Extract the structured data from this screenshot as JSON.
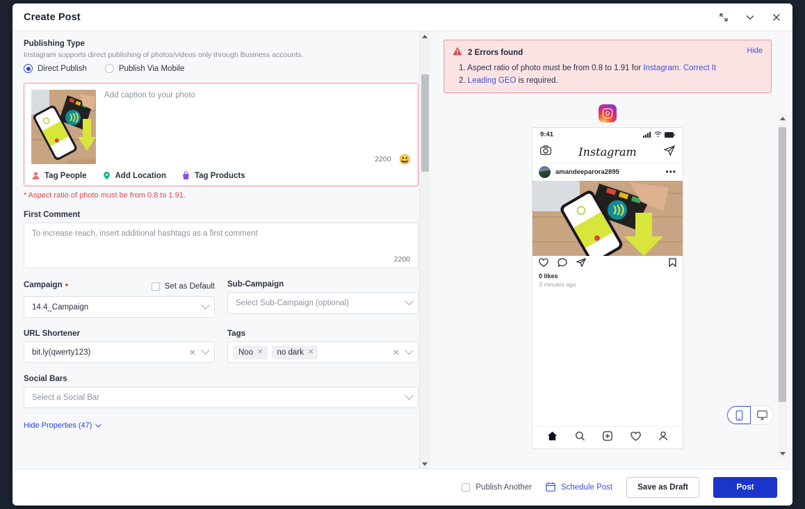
{
  "window": {
    "title": "Create Post",
    "header_icons": [
      {
        "name": "collapse-icon",
        "glyph": "collapse"
      },
      {
        "name": "chevron-down-icon",
        "glyph": "chevron-down"
      },
      {
        "name": "close-icon",
        "glyph": "close"
      }
    ]
  },
  "left": {
    "publishing_type": {
      "label": "Publishing Type",
      "description": "Instagram supports direct publishing of photos/videos only through Business accounts.",
      "options": [
        {
          "label": "Direct Publish",
          "selected": true
        },
        {
          "label": "Publish Via Mobile",
          "selected": false
        }
      ]
    },
    "media": {
      "caption_placeholder": "Add caption to your photo",
      "char_count": "2200",
      "emoji": "😃",
      "actions": [
        {
          "label": "Tag People",
          "icon": "tag-people-icon",
          "color": "#f2707a"
        },
        {
          "label": "Add Location",
          "icon": "location-pin-icon",
          "color": "#09b87e"
        },
        {
          "label": "Tag Products",
          "icon": "shopping-bag-icon",
          "color": "#8b4ee8"
        }
      ],
      "error_text": "* Aspect ratio of photo must be from 0.8 to 1.91."
    },
    "first_comment": {
      "label": "First Comment",
      "placeholder": "To increase reach, insert additional hashtags as a first comment",
      "char_count": "2200"
    },
    "campaign": {
      "label": "Campaign",
      "required": true,
      "value": "14.4_Campaign",
      "set_as_default_label": "Set as Default",
      "set_as_default_checked": false
    },
    "sub_campaign": {
      "label": "Sub-Campaign",
      "placeholder": "Select Sub-Campaign (optional)"
    },
    "url_shortener": {
      "label": "URL Shortener",
      "value": "bit.ly(qwerty123)"
    },
    "tags": {
      "label": "Tags",
      "chips": [
        "Noo",
        "no dark"
      ]
    },
    "social_bars": {
      "label": "Social Bars",
      "placeholder": "Select a Social Bar"
    },
    "hide_properties": "Hide Properties (47)"
  },
  "right": {
    "errors": {
      "title": "2 Errors found",
      "hide_label": "Hide",
      "items": [
        {
          "number": "1.",
          "text": "Aspect ratio of photo must be from 0.8 to 1.91 for ",
          "link": "Instagram. Correct It",
          "suffix": ""
        },
        {
          "number": "2.",
          "text": "",
          "link": "Leading GEO",
          "suffix": " is required."
        }
      ],
      "bg_color": "#fbe3e4",
      "border_color": "#f0969c",
      "link_color": "#3a52d8"
    },
    "preview": {
      "network_icon": "instagram-icon",
      "status_time": "9:41",
      "app_name": "Instagram",
      "username": "amandeeparora2895",
      "likes": "0 likes",
      "timestamp": "3 minutes ago",
      "nav_icons": [
        "home-icon",
        "search-icon",
        "add-post-icon",
        "heart-icon",
        "profile-icon"
      ],
      "post_icons": [
        "heart-icon",
        "comment-icon",
        "share-icon",
        "bookmark-icon"
      ]
    },
    "device_toggle": [
      {
        "name": "mobile-view-icon",
        "active": true
      },
      {
        "name": "desktop-view-icon",
        "active": false
      }
    ]
  },
  "footer": {
    "publish_another_label": "Publish Another",
    "publish_another_checked": false,
    "schedule_post_label": "Schedule Post",
    "save_draft_label": "Save as Draft",
    "post_label": "Post",
    "primary_color": "#1b34c9"
  }
}
